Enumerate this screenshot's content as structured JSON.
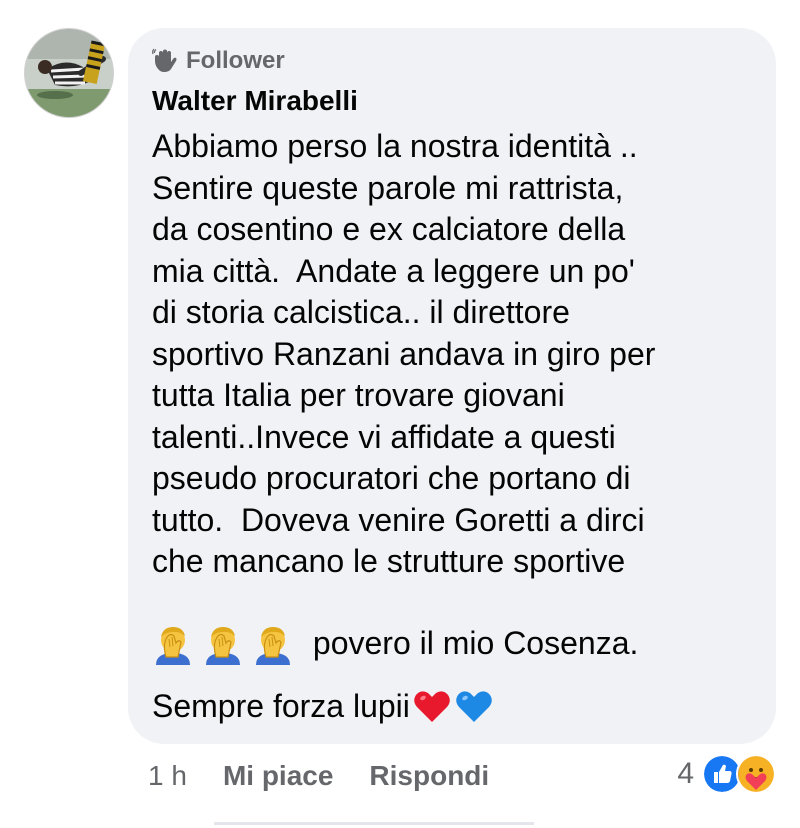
{
  "comment": {
    "badge_label": "Follower",
    "author": "Walter Mirabelli",
    "body_lines": [
      "Abbiamo perso la nostra identità ..",
      "Sentire queste parole mi rattrista,",
      "da cosentino e ex calciatore della",
      "mia città.  Andate a leggere un po'",
      "di storia calcistica.. il direttore",
      "sportivo Ranzani andava in giro per",
      "tutta Italia per trovare giovani",
      "talenti..Invece vi affidate a questi",
      "pseudo procuratori che portano di",
      "tutto.  Doveva venire Goretti a dirci",
      "che mancano le strutture sportive"
    ],
    "facepalm_tail": " povero il mio Cosenza.",
    "closing_text": "Sempre forza lupii",
    "emojis": {
      "facepalm": "man-facepalming-emoji",
      "red_heart": "red-heart-emoji",
      "blue_heart": "blue-heart-emoji"
    }
  },
  "actions": {
    "time": "1 h",
    "like": "Mi piace",
    "reply": "Rispondi"
  },
  "reactions": {
    "count": "4",
    "icons": [
      "like-icon",
      "care-icon"
    ],
    "colors": {
      "like": "#1877f2",
      "care": "#f7b125"
    }
  },
  "colors": {
    "bubble": "#f0f2f5",
    "secondary_text": "#65676b",
    "primary_text": "#050505"
  }
}
